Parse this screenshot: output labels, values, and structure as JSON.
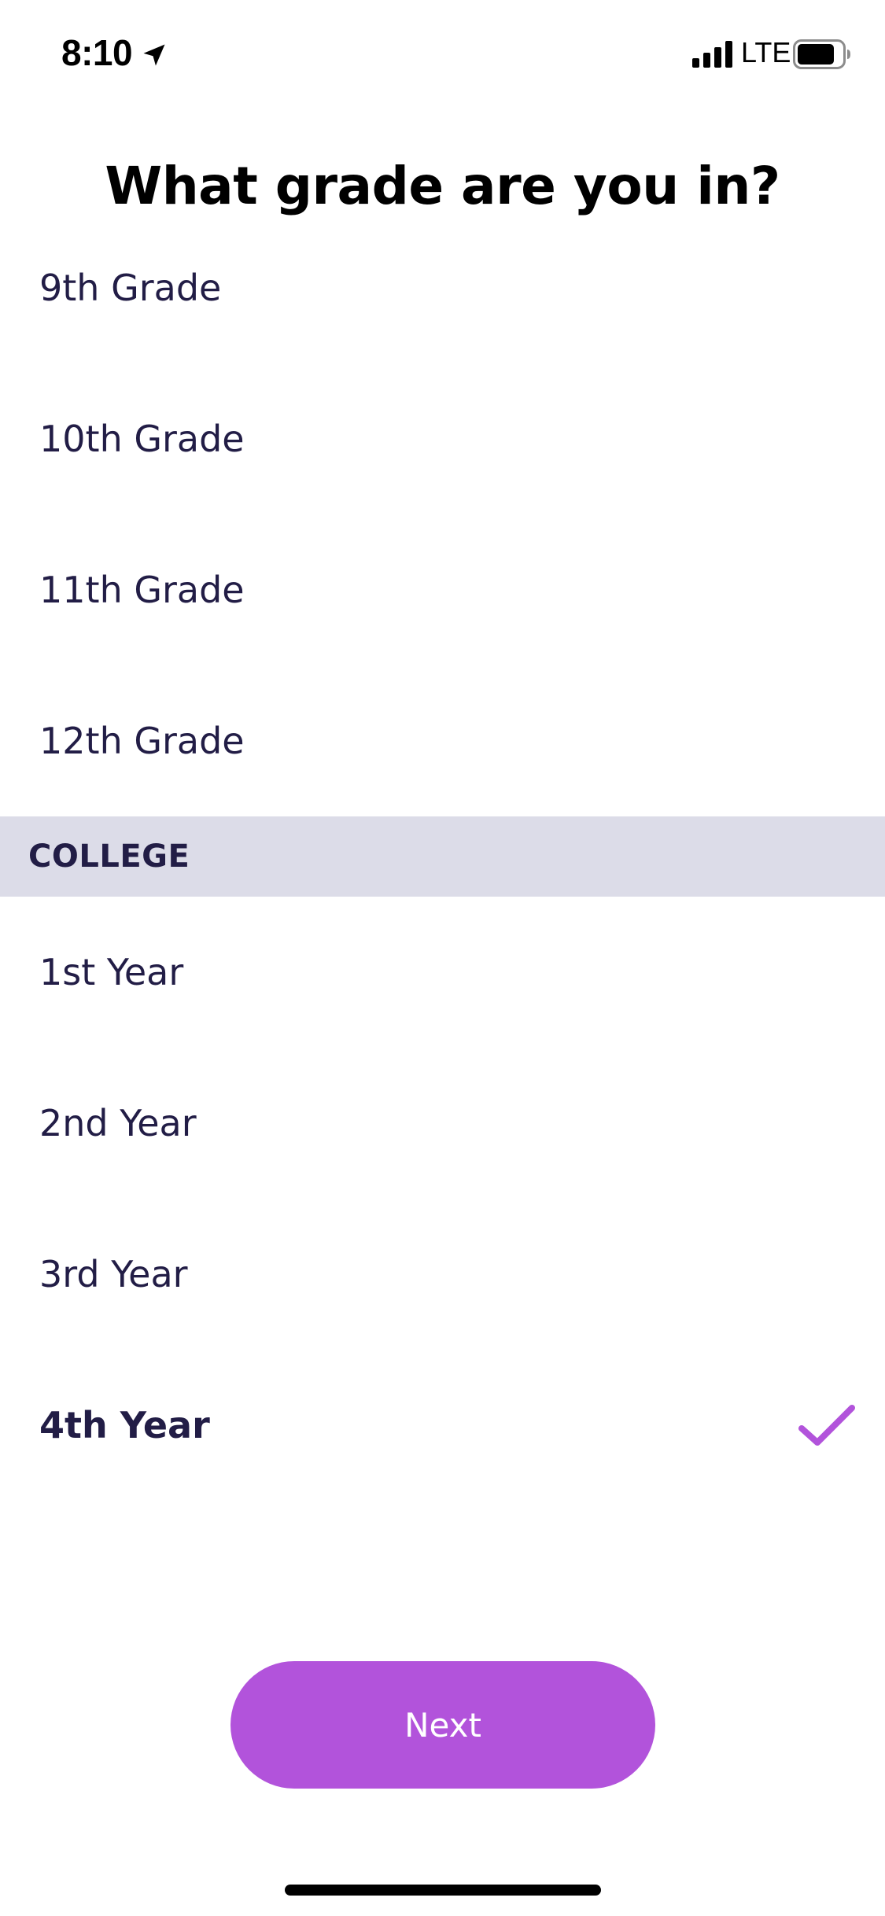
{
  "status_bar": {
    "time": "8:10",
    "network": "LTE"
  },
  "title": "What grade are you in?",
  "list": {
    "high_school_items": [
      {
        "label": "9th Grade"
      },
      {
        "label": "10th Grade"
      },
      {
        "label": "11th Grade"
      },
      {
        "label": "12th Grade"
      }
    ],
    "college_header": "COLLEGE",
    "college_items": [
      {
        "label": "1st Year"
      },
      {
        "label": "2nd Year"
      },
      {
        "label": "3rd Year"
      },
      {
        "label": "4th Year",
        "selected": true
      }
    ]
  },
  "next_button": {
    "label": "Next"
  },
  "colors": {
    "accent": "#b253db",
    "text": "#221d46",
    "section_bg": "#dcdce8"
  },
  "icons": {
    "location": "location-arrow-icon",
    "signal": "signal-bars-icon",
    "battery": "battery-icon",
    "check": "checkmark-icon"
  }
}
